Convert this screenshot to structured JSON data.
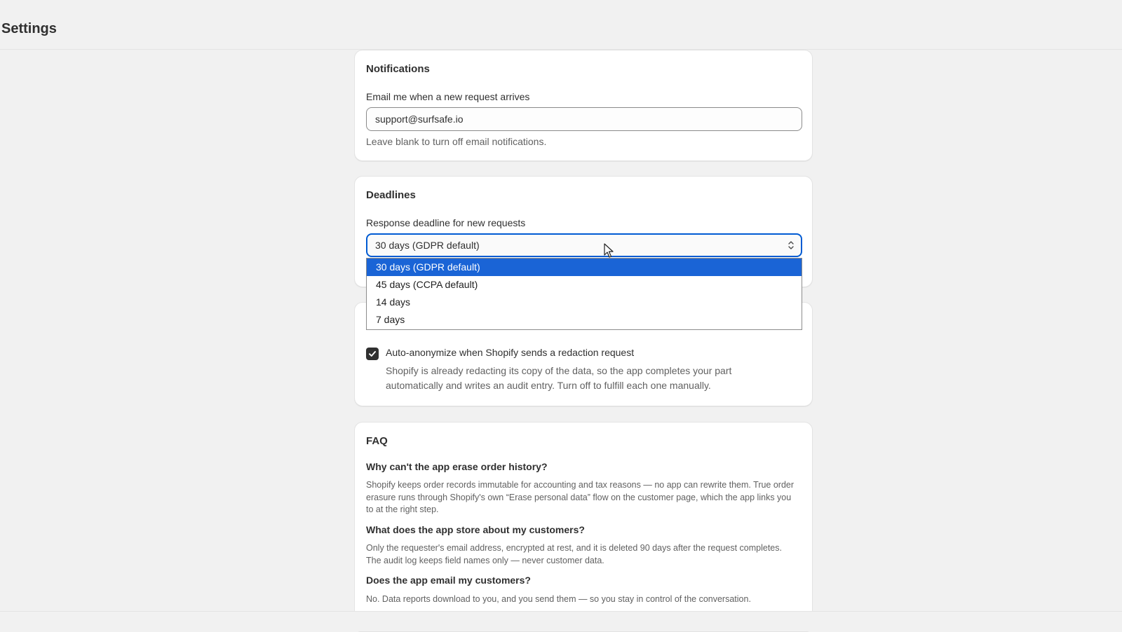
{
  "page": {
    "title": "Settings"
  },
  "notifications": {
    "title": "Notifications",
    "email_label": "Email me when a new request arrives",
    "email_value": "support@surfsafe.io",
    "help": "Leave blank to turn off email notifications."
  },
  "deadlines": {
    "title": "Deadlines",
    "label": "Response deadline for new requests",
    "selected": "30 days (GDPR default)",
    "options": [
      "30 days (GDPR default)",
      "45 days (CCPA default)",
      "14 days",
      "7 days"
    ]
  },
  "redaction": {
    "checked": true,
    "label": "Auto-anonymize when Shopify sends a redaction request",
    "help": "Shopify is already redacting its copy of the data, so the app completes your part automatically and writes an audit entry. Turn off to fulfill each one manually."
  },
  "faq": {
    "title": "FAQ",
    "items": [
      {
        "q": "Why can't the app erase order history?",
        "a": "Shopify keeps order records immutable for accounting and tax reasons — no app can rewrite them. True order erasure runs through Shopify's own “Erase personal data” flow on the customer page, which the app links you to at the right step."
      },
      {
        "q": "What does the app store about my customers?",
        "a": "Only the requester's email address, encrypted at rest, and it is deleted 90 days after the request completes. The audit log keeps field names only — never customer data."
      },
      {
        "q": "Does the app email my customers?",
        "a": "No. Data reports download to you, and you send them — so you stay in control of the conversation."
      }
    ]
  },
  "colors": {
    "background": "#f1f1f1",
    "card": "#ffffff",
    "focus": "#005bd3",
    "option_selected": "#1a64d6",
    "checkbox": "#303030"
  },
  "icons": {
    "select": "chevron-up-down-icon",
    "check": "checkmark-icon",
    "cursor": "mouse-pointer-icon"
  }
}
